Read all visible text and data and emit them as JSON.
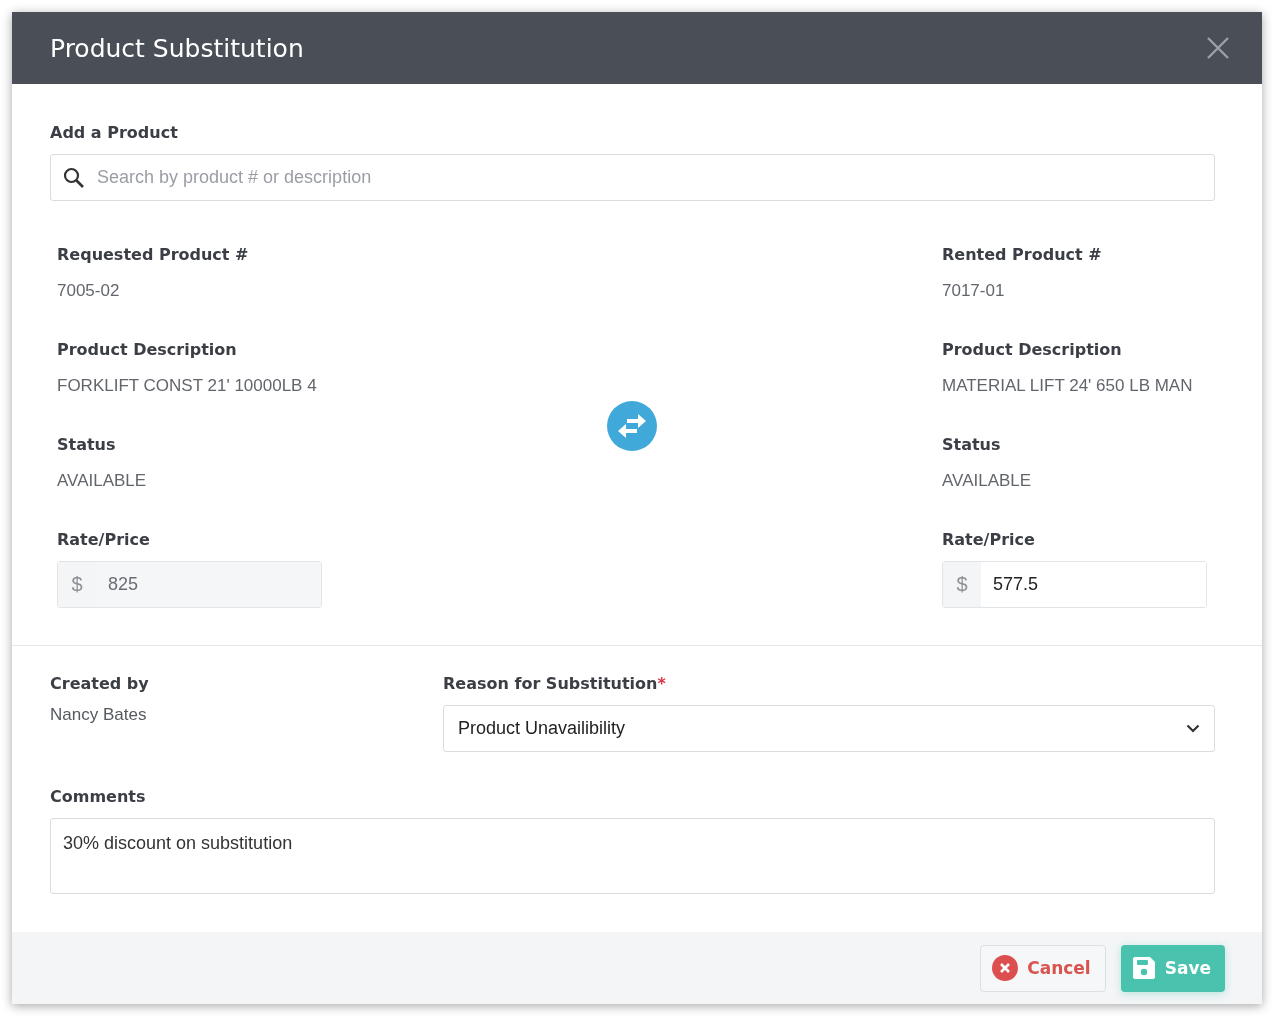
{
  "dialog": {
    "title": "Product Substitution"
  },
  "add_product": {
    "label": "Add a Product",
    "search": {
      "placeholder": "Search by product # or description"
    }
  },
  "products": [
    {
      "number_label": "Requested Product #",
      "number": "7005-02",
      "description_label": "Product Description",
      "description": "FORKLIFT CONST 21' 10000LB 4",
      "status_label": "Status",
      "status": "AVAILABLE",
      "rate_label": "Rate/Price",
      "currency": "$",
      "rate": "825",
      "disabled": true
    },
    {
      "number_label": "Rented Product #",
      "number": "7017-01",
      "description_label": "Product Description",
      "description": "MATERIAL LIFT 24' 650 LB MAN",
      "status_label": "Status",
      "status": "AVAILABLE",
      "rate_label": "Rate/Price",
      "currency": "$",
      "rate": "577.5",
      "disabled": false
    }
  ],
  "created_by": {
    "label": "Created by",
    "value": "Nancy Bates"
  },
  "reason": {
    "label": "Reason for Substitution",
    "required_mark": "*",
    "value": "Product Unavailibility"
  },
  "comments": {
    "label": "Comments",
    "value": "30% discount on substitution"
  },
  "buttons": [
    {
      "kind": "cancel",
      "label": "Cancel"
    },
    {
      "kind": "save",
      "label": "Save"
    }
  ]
}
